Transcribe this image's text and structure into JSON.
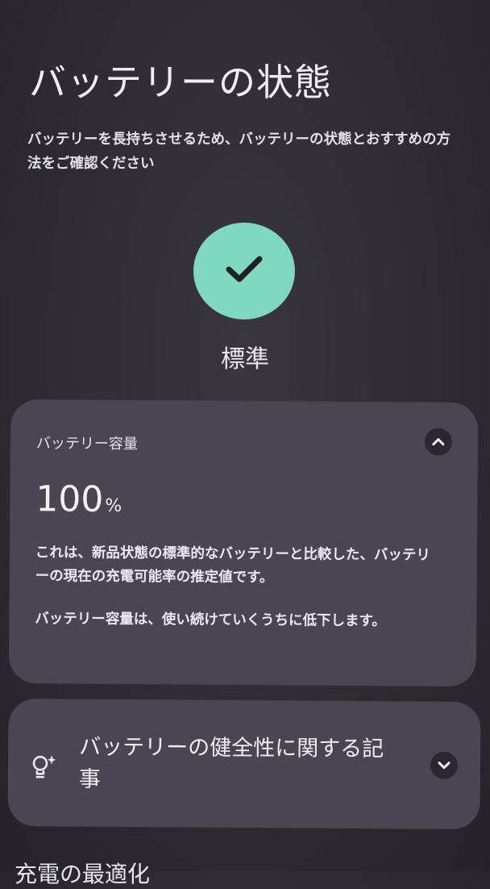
{
  "page": {
    "title": "バッテリーの状態",
    "subtitle": "バッテリーを長持ちさせるため、バッテリーの状態とおすすめの方法をご確認ください"
  },
  "status": {
    "label": "標準",
    "icon": "check-icon",
    "color": "#7fd8bf"
  },
  "capacity_card": {
    "header": "バッテリー容量",
    "value": "100",
    "unit": "%",
    "description_1": "これは、新品状態の標準的なバッテリーと比較した、バッテリーの現在の充電可能率の推定値です。",
    "description_2": "バッテリー容量は、使い続けていくうちに低下します。",
    "toggle_icon": "chevron-up-icon"
  },
  "articles_card": {
    "title": "バッテリーの健全性に関する記事",
    "icon": "lightbulb-sparkle-icon",
    "toggle_icon": "chevron-down-icon"
  },
  "next_section": {
    "label": "充電の最適化"
  }
}
